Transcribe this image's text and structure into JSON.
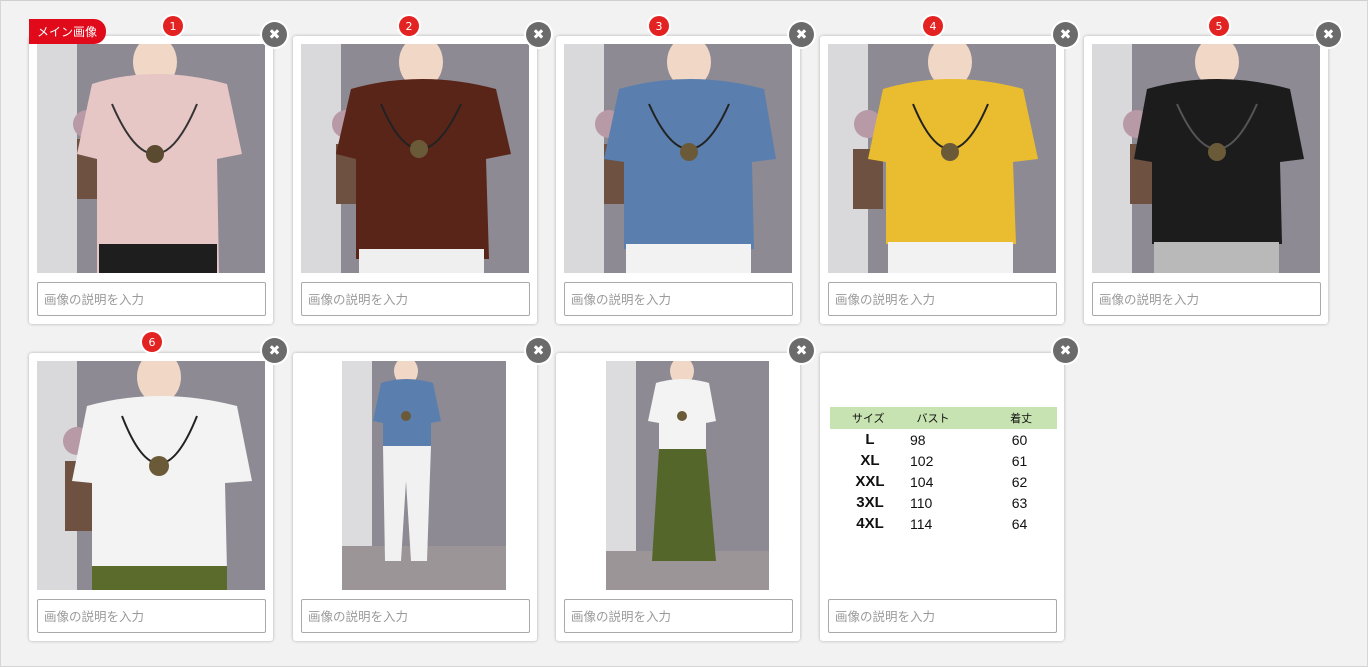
{
  "main_badge": "メイン画像",
  "description_placeholder": "画像の説明を入力",
  "colors": {
    "badge_red": "#e00a1a",
    "number_red": "#e32222",
    "close_gray": "#6b6b6b"
  },
  "images": [
    {
      "number": "1",
      "shirt": "pale pink short-sleeve tee",
      "shirt_color": "#e7c6c6",
      "bottom_color": "#1e1e1e",
      "close_icon": "close-icon"
    },
    {
      "number": "2",
      "shirt": "brown short-sleeve tee",
      "shirt_color": "#5a2519",
      "bottom_color": "#efefef",
      "close_icon": "close-icon"
    },
    {
      "number": "3",
      "shirt": "blue short-sleeve tee",
      "shirt_color": "#5a7fae",
      "bottom_color": "#f2f2f2",
      "close_icon": "close-icon"
    },
    {
      "number": "4",
      "shirt": "yellow short-sleeve tee",
      "shirt_color": "#e9bd2f",
      "bottom_color": "#f2f2f2",
      "close_icon": "close-icon"
    },
    {
      "number": "5",
      "shirt": "black short-sleeve tee",
      "shirt_color": "#1c1c1c",
      "bottom_color": "#b9b9b9",
      "close_icon": "close-icon"
    },
    {
      "number": "6",
      "shirt": "white short-sleeve tee",
      "shirt_color": "#f3f3f3",
      "bottom_color": "#5a6b2c",
      "close_icon": "close-icon"
    },
    {
      "number": "",
      "shirt": "blue tee with white pants",
      "shirt_color": "#5a7fae",
      "bottom_color": "#f1f1f1",
      "close_icon": "close-icon"
    },
    {
      "number": "",
      "shirt": "white tee with olive pants",
      "shirt_color": "#f3f3f3",
      "bottom_color": "#55662a",
      "close_icon": "close-icon"
    },
    {
      "number": "",
      "shirt": "size chart",
      "close_icon": "close-icon"
    }
  ],
  "size_chart": {
    "headers": [
      "サイズ",
      "バスト",
      "着丈"
    ],
    "rows": [
      [
        "L",
        "98",
        "60"
      ],
      [
        "XL",
        "102",
        "61"
      ],
      [
        "XXL",
        "104",
        "62"
      ],
      [
        "3XL",
        "110",
        "63"
      ],
      [
        "4XL",
        "114",
        "64"
      ]
    ]
  }
}
